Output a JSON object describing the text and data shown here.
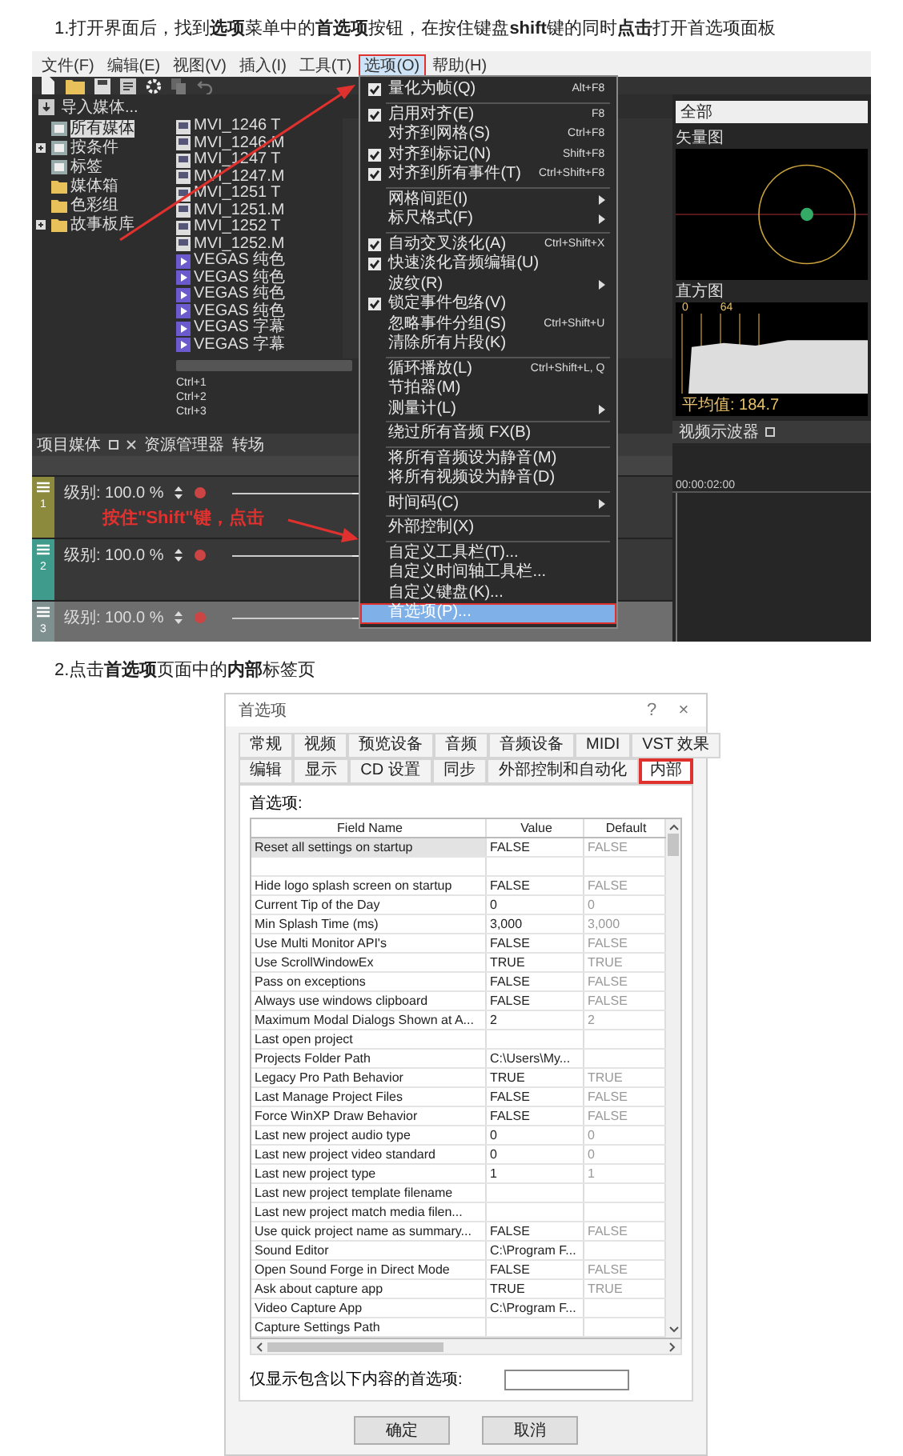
{
  "step_1": {
    "text": "1.打开界面后，找到**选项**菜单中的**首选项**按钮，在按住键盘**shift**键的同时**点击**打开首选项面板"
  },
  "editor_screenshot": {
    "menubar": [
      {
        "label": "文件(F)",
        "selected": false
      },
      {
        "label": "编辑(E)",
        "selected": false
      },
      {
        "label": "视图(V)",
        "selected": false
      },
      {
        "label": "插入(I)",
        "selected": false
      },
      {
        "label": "工具(T)",
        "selected": false
      },
      {
        "label": "选项(O)",
        "selected": true
      },
      {
        "label": "帮助(H)",
        "selected": false
      }
    ],
    "import_label": "导入媒体...",
    "tree": [
      {
        "label": "所有媒体",
        "kind": "view",
        "selected": true
      },
      {
        "label": "按条件",
        "kind": "view",
        "selected": false,
        "expanded": false
      },
      {
        "label": "标签",
        "kind": "view",
        "selected": false
      },
      {
        "label": "媒体箱",
        "kind": "folder",
        "selected": false
      },
      {
        "label": "色彩组",
        "kind": "folder",
        "selected": false
      },
      {
        "label": "故事板库",
        "kind": "folder",
        "selected": false,
        "expanded": false
      }
    ],
    "files": [
      {
        "name": "MVI_1246 T",
        "kind": "media"
      },
      {
        "name": "MVI_1246.M",
        "kind": "media"
      },
      {
        "name": "MVI_1247 T",
        "kind": "media"
      },
      {
        "name": "MVI_1247.M",
        "kind": "media"
      },
      {
        "name": "MVI_1251 T",
        "kind": "media"
      },
      {
        "name": "MVI_1251.M",
        "kind": "media"
      },
      {
        "name": "MVI_1252 T",
        "kind": "media"
      },
      {
        "name": "MVI_1252.M",
        "kind": "media"
      },
      {
        "name": "VEGAS 纯色",
        "kind": "generator"
      },
      {
        "name": "VEGAS 纯色",
        "kind": "generator"
      },
      {
        "name": "VEGAS 纯色",
        "kind": "generator"
      },
      {
        "name": "VEGAS 纯色",
        "kind": "generator"
      },
      {
        "name": "VEGAS 字幕",
        "kind": "generator"
      },
      {
        "name": "VEGAS 字幕",
        "kind": "generator"
      }
    ],
    "shortcuts": [
      "Ctrl+1",
      "Ctrl+2",
      "Ctrl+3"
    ],
    "panel_tabs": [
      "项目媒体",
      "资源管理器",
      "转场"
    ],
    "tracks": [
      {
        "number": "1",
        "color": "#8c8a3c",
        "level_label": "级别: 100.0 %",
        "level": 1
      },
      {
        "number": "2",
        "color": "#3f9c8c",
        "level_label": "级别: 100.0 %",
        "level": 1
      },
      {
        "number": "3",
        "color": "#7f9090",
        "level_label": "级别: 100.0 %",
        "level": 1
      }
    ],
    "menu": [
      {
        "kind": "item",
        "label": "量化为帧(Q)",
        "shortcut": "Alt+F8",
        "checked": true,
        "submenu": false,
        "selected": false
      },
      {
        "kind": "separator"
      },
      {
        "kind": "item",
        "label": "启用对齐(E)",
        "shortcut": "F8",
        "checked": true,
        "submenu": false,
        "selected": false
      },
      {
        "kind": "item",
        "label": "对齐到网格(S)",
        "shortcut": "Ctrl+F8",
        "checked": false,
        "submenu": false,
        "selected": false
      },
      {
        "kind": "item",
        "label": "对齐到标记(N)",
        "shortcut": "Shift+F8",
        "checked": true,
        "submenu": false,
        "selected": false
      },
      {
        "kind": "item",
        "label": "对齐到所有事件(T)",
        "shortcut": "Ctrl+Shift+F8",
        "checked": true,
        "submenu": false,
        "selected": false
      },
      {
        "kind": "separator"
      },
      {
        "kind": "item",
        "label": "网格间距(I)",
        "checked": false,
        "submenu": true,
        "selected": false
      },
      {
        "kind": "item",
        "label": "标尺格式(F)",
        "checked": false,
        "submenu": true,
        "selected": false
      },
      {
        "kind": "separator"
      },
      {
        "kind": "item",
        "label": "自动交叉淡化(A)",
        "shortcut": "Ctrl+Shift+X",
        "checked": true,
        "submenu": false,
        "selected": false
      },
      {
        "kind": "item",
        "label": "快速淡化音频编辑(U)",
        "checked": true,
        "submenu": false,
        "selected": false
      },
      {
        "kind": "item",
        "label": "波纹(R)",
        "checked": false,
        "submenu": true,
        "selected": false
      },
      {
        "kind": "item",
        "label": "锁定事件包络(V)",
        "checked": true,
        "submenu": false,
        "selected": false
      },
      {
        "kind": "item",
        "label": "忽略事件分组(S)",
        "shortcut": "Ctrl+Shift+U",
        "checked": false,
        "submenu": false,
        "selected": false
      },
      {
        "kind": "item",
        "label": "清除所有片段(K)",
        "checked": false,
        "submenu": false,
        "selected": false
      },
      {
        "kind": "separator"
      },
      {
        "kind": "item",
        "label": "循环播放(L)",
        "shortcut": "Ctrl+Shift+L, Q",
        "checked": false,
        "submenu": false,
        "selected": false
      },
      {
        "kind": "item",
        "label": "节拍器(M)",
        "checked": false,
        "submenu": false,
        "selected": false
      },
      {
        "kind": "item",
        "label": "测量计(L)",
        "checked": false,
        "submenu": true,
        "selected": false
      },
      {
        "kind": "separator"
      },
      {
        "kind": "item",
        "label": "绕过所有音频 FX(B)",
        "checked": false,
        "submenu": false,
        "selected": false
      },
      {
        "kind": "separator"
      },
      {
        "kind": "item",
        "label": "将所有音频设为静音(M)",
        "checked": false,
        "submenu": false,
        "selected": false
      },
      {
        "kind": "item",
        "label": "将所有视频设为静音(D)",
        "checked": false,
        "submenu": false,
        "selected": false
      },
      {
        "kind": "separator"
      },
      {
        "kind": "item",
        "label": "时间码(C)",
        "checked": false,
        "submenu": true,
        "selected": false
      },
      {
        "kind": "separator"
      },
      {
        "kind": "item",
        "label": "外部控制(X)",
        "checked": false,
        "submenu": false,
        "selected": false
      },
      {
        "kind": "separator"
      },
      {
        "kind": "item",
        "label": "自定义工具栏(T)...",
        "checked": false,
        "submenu": false,
        "selected": false
      },
      {
        "kind": "item",
        "label": "自定义时间轴工具栏...",
        "checked": false,
        "submenu": false,
        "selected": false
      },
      {
        "kind": "item",
        "label": "自定义键盘(K)...",
        "checked": false,
        "submenu": false,
        "selected": false
      },
      {
        "kind": "item",
        "label": "首选项(P)...",
        "checked": false,
        "submenu": false,
        "selected": true
      }
    ],
    "annotation": "按住\"Shift\"键，点击",
    "scope": {
      "dropdown": "全部",
      "vectorscope_label": "矢量图",
      "histogram_label": "直方图",
      "histogram_labels": [
        "0",
        "64"
      ],
      "average": "平均值: 184.7",
      "tab": "视频示波器"
    },
    "timecode": "00:00:02:00"
  },
  "step_2": {
    "text": "2.点击**首选项**页面中的**内部**标签页"
  },
  "preferences_dialog": {
    "title": "首选项",
    "help": "?",
    "close": "×",
    "tabs_row_1": [
      {
        "label": "常规",
        "selected": false
      },
      {
        "label": "视频",
        "selected": false
      },
      {
        "label": "预览设备",
        "selected": false
      },
      {
        "label": "音频",
        "selected": false
      },
      {
        "label": "音频设备",
        "selected": false
      },
      {
        "label": "MIDI",
        "selected": false
      },
      {
        "label": "VST 效果",
        "selected": false
      }
    ],
    "tabs_row_2": [
      {
        "label": "编辑",
        "selected": false
      },
      {
        "label": "显示",
        "selected": false
      },
      {
        "label": "CD 设置",
        "selected": false
      },
      {
        "label": "同步",
        "selected": false
      },
      {
        "label": "外部控制和自动化",
        "selected": false
      },
      {
        "label": "内部",
        "selected": true
      }
    ],
    "section_label": "首选项:",
    "columns": [
      "Field Name",
      "Value",
      "Default"
    ],
    "rows": [
      {
        "field": "Reset all settings on startup",
        "value": "FALSE",
        "default": "FALSE",
        "selected": true
      },
      {
        "field": "",
        "value": "",
        "default": "",
        "selected": false
      },
      {
        "field": "Hide logo splash screen on startup",
        "value": "FALSE",
        "default": "FALSE",
        "selected": false
      },
      {
        "field": "Current Tip of the Day",
        "value": "0",
        "default": "0",
        "selected": false
      },
      {
        "field": "Min Splash Time (ms)",
        "value": "3,000",
        "default": "3,000",
        "selected": false
      },
      {
        "field": "Use Multi Monitor API's",
        "value": "FALSE",
        "default": "FALSE",
        "selected": false
      },
      {
        "field": "Use ScrollWindowEx",
        "value": "TRUE",
        "default": "TRUE",
        "selected": false
      },
      {
        "field": "Pass on exceptions",
        "value": "FALSE",
        "default": "FALSE",
        "selected": false
      },
      {
        "field": "Always use windows clipboard",
        "value": "FALSE",
        "default": "FALSE",
        "selected": false
      },
      {
        "field": "Maximum Modal Dialogs Shown at A...",
        "value": "2",
        "default": "2",
        "selected": false
      },
      {
        "field": "Last open project",
        "value": "",
        "default": "",
        "selected": false
      },
      {
        "field": "Projects Folder Path",
        "value": "C:\\Users\\My...",
        "default": "",
        "selected": false
      },
      {
        "field": "Legacy Pro Path Behavior",
        "value": "TRUE",
        "default": "TRUE",
        "selected": false
      },
      {
        "field": "Last Manage Project Files",
        "value": "FALSE",
        "default": "FALSE",
        "selected": false
      },
      {
        "field": "Force WinXP Draw Behavior",
        "value": "FALSE",
        "default": "FALSE",
        "selected": false
      },
      {
        "field": "Last new project audio type",
        "value": "0",
        "default": "0",
        "selected": false
      },
      {
        "field": "Last new project video standard",
        "value": "0",
        "default": "0",
        "selected": false
      },
      {
        "field": "Last new project type",
        "value": "1",
        "default": "1",
        "selected": false
      },
      {
        "field": "Last new project template filename",
        "value": "",
        "default": "",
        "selected": false
      },
      {
        "field": "Last new project match media filen...",
        "value": "",
        "default": "",
        "selected": false
      },
      {
        "field": "Use quick project name as summary...",
        "value": "FALSE",
        "default": "FALSE",
        "selected": false
      },
      {
        "field": "Sound Editor",
        "value": "C:\\Program F...",
        "default": "",
        "selected": false
      },
      {
        "field": "Open Sound Forge in Direct Mode",
        "value": "FALSE",
        "default": "FALSE",
        "selected": false
      },
      {
        "field": "Ask about capture app",
        "value": "TRUE",
        "default": "TRUE",
        "selected": false
      },
      {
        "field": "Video Capture App",
        "value": "C:\\Program F...",
        "default": "",
        "selected": false
      },
      {
        "field": "Capture Settings Path",
        "value": "",
        "default": "",
        "selected": false
      }
    ],
    "filter_label": "仅显示包含以下内容的首选项:",
    "buttons": [
      "确定",
      "取消"
    ]
  }
}
